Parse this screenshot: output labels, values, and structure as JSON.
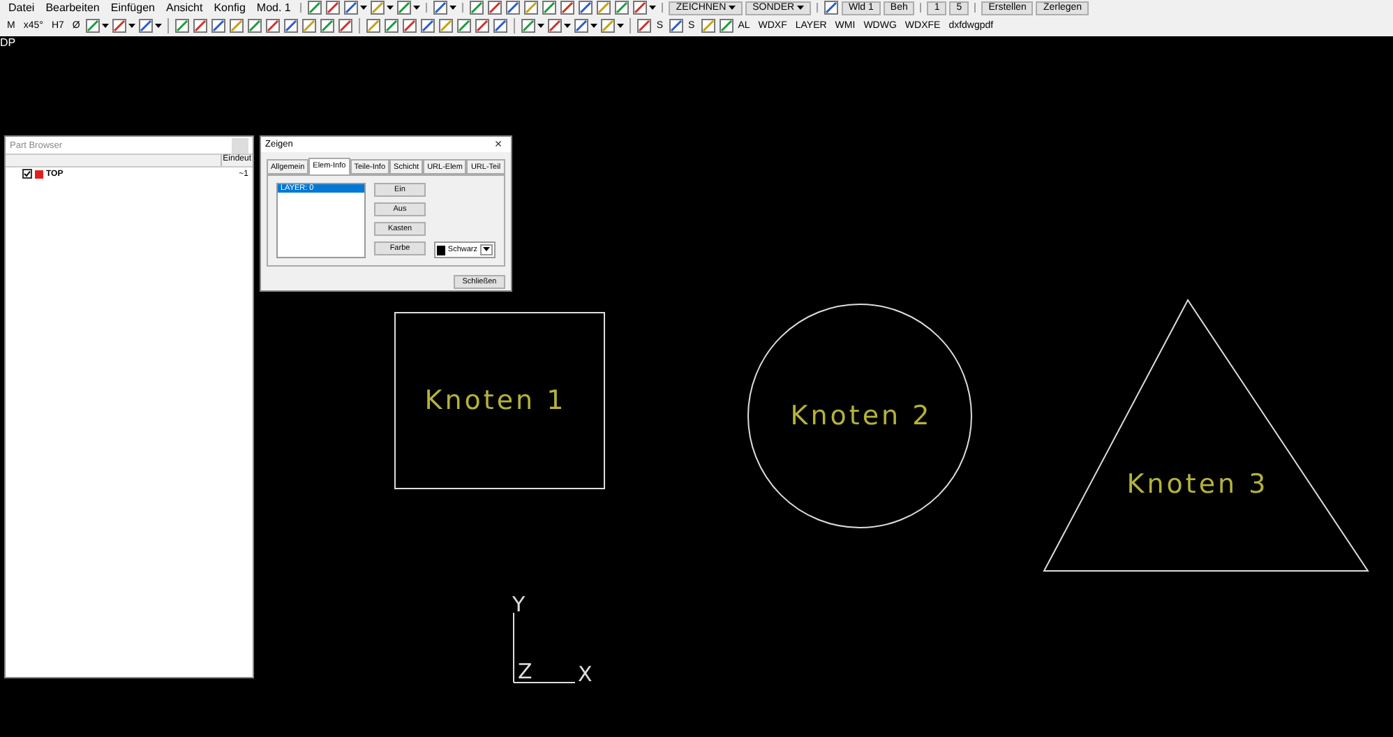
{
  "menu": [
    "Datei",
    "Bearbeiten",
    "Einfügen",
    "Ansicht",
    "Konfig",
    "Mod. 1"
  ],
  "toolbar_top": [
    {
      "kind": "icon"
    },
    {
      "kind": "icon"
    },
    {
      "kind": "dropicon"
    },
    {
      "kind": "dropicon"
    },
    {
      "kind": "dropicon"
    },
    {
      "kind": "sep"
    },
    {
      "kind": "dropicon"
    },
    {
      "kind": "sep"
    },
    {
      "kind": "icon"
    },
    {
      "kind": "icon"
    },
    {
      "kind": "icon"
    },
    {
      "kind": "icon"
    },
    {
      "kind": "icon"
    },
    {
      "kind": "icon"
    },
    {
      "kind": "icon"
    },
    {
      "kind": "icon"
    },
    {
      "kind": "icon"
    },
    {
      "kind": "dropicon"
    },
    {
      "kind": "sep"
    },
    {
      "kind": "dropdown",
      "text": "ZEICHNEN"
    },
    {
      "kind": "dropdown",
      "text": "SONDER"
    },
    {
      "kind": "sep"
    },
    {
      "kind": "icon"
    },
    {
      "kind": "button",
      "text": "Wld 1"
    },
    {
      "kind": "button",
      "text": "Beh"
    },
    {
      "kind": "sep"
    },
    {
      "kind": "button",
      "text": "1"
    },
    {
      "kind": "button",
      "text": "5"
    },
    {
      "kind": "sep"
    },
    {
      "kind": "button",
      "text": "Erstellen"
    },
    {
      "kind": "button",
      "text": "Zerlegen"
    }
  ],
  "toolbar_bottom": [
    {
      "kind": "text",
      "text": "M"
    },
    {
      "kind": "text",
      "text": "x45°"
    },
    {
      "kind": "text",
      "text": "H7"
    },
    {
      "kind": "text",
      "text": "Ø"
    },
    {
      "kind": "dropicon"
    },
    {
      "kind": "dropicon"
    },
    {
      "kind": "dropicon"
    },
    {
      "kind": "sep"
    },
    {
      "kind": "icon"
    },
    {
      "kind": "icon"
    },
    {
      "kind": "icon"
    },
    {
      "kind": "icon"
    },
    {
      "kind": "icon"
    },
    {
      "kind": "icon"
    },
    {
      "kind": "icon"
    },
    {
      "kind": "icon"
    },
    {
      "kind": "icon"
    },
    {
      "kind": "icon"
    },
    {
      "kind": "sep"
    },
    {
      "kind": "icon"
    },
    {
      "kind": "icon"
    },
    {
      "kind": "icon"
    },
    {
      "kind": "icon"
    },
    {
      "kind": "icon"
    },
    {
      "kind": "icon"
    },
    {
      "kind": "icon"
    },
    {
      "kind": "icon"
    },
    {
      "kind": "sep"
    },
    {
      "kind": "dropicon"
    },
    {
      "kind": "dropicon"
    },
    {
      "kind": "dropicon"
    },
    {
      "kind": "dropicon"
    },
    {
      "kind": "sep"
    },
    {
      "kind": "iconlabel",
      "text": "S"
    },
    {
      "kind": "iconlabel",
      "text": "S"
    },
    {
      "kind": "icon"
    },
    {
      "kind": "iconlabel",
      "text": "AL"
    },
    {
      "kind": "text",
      "text": "WDXF"
    },
    {
      "kind": "text",
      "text": "LAYER"
    },
    {
      "kind": "text",
      "text": "WMI"
    },
    {
      "kind": "text",
      "text": "WDWG"
    },
    {
      "kind": "text",
      "text": "WDXFE"
    },
    {
      "kind": "text",
      "text": "dxfdwgpdf"
    }
  ],
  "view_label": "DP",
  "part_browser": {
    "title": "Part Browser",
    "column_2": "Eindeut",
    "tree": [
      {
        "label": "TOP",
        "checked": true,
        "value": "~1"
      }
    ]
  },
  "dialog": {
    "title": "Zeigen",
    "close": "×",
    "tabs": [
      {
        "label": "Allgemein",
        "selected": false
      },
      {
        "label": "Elem-Info",
        "selected": true
      },
      {
        "label": "Teile-Info",
        "selected": false
      },
      {
        "label": "Schicht",
        "selected": false
      },
      {
        "label": "URL-Elem",
        "selected": false
      },
      {
        "label": "URL-Teil",
        "selected": false
      }
    ],
    "list": [
      {
        "label": "LAYER: 0",
        "selected": true
      }
    ],
    "buttons": [
      "Ein",
      "Aus",
      "Kasten",
      "Farbe"
    ],
    "color_select": {
      "value": "Schwarz",
      "color": "#000000"
    },
    "close_button": "Schließen"
  },
  "nodes": [
    {
      "kind": "rect",
      "label": "Knoten 1"
    },
    {
      "kind": "circle",
      "label": "Knoten 2"
    },
    {
      "kind": "triangle",
      "label": "Knoten 3"
    }
  ],
  "axes": {
    "y": "Y",
    "z": "Z",
    "x": "X"
  }
}
